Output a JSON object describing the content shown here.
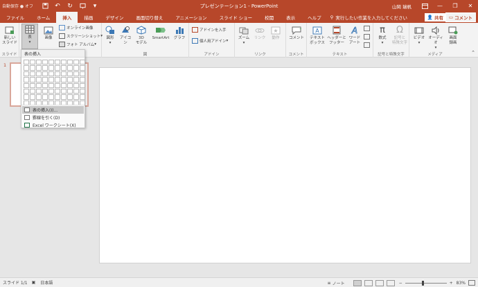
{
  "titlebar": {
    "autosave": "自動保存 ● オフ",
    "title": "プレゼンテーション1 - PowerPoint",
    "user": "山岡 瑞帆"
  },
  "tabs": [
    "ファイル",
    "ホーム",
    "挿入",
    "描画",
    "デザイン",
    "画面切り替え",
    "アニメーション",
    "スライド ショー",
    "校閲",
    "表示",
    "ヘルプ"
  ],
  "active_tab": "挿入",
  "tellme": "実行したい作業を入力してください",
  "share": "共有",
  "comment": "コメント",
  "ribbon": {
    "new_slide": "新しい\nスライド",
    "table": "表",
    "images": "画像",
    "online_images": "オンライン画像",
    "screenshot": "スクリーンショット",
    "photo_album": "フォト アルバム",
    "shapes": "図形",
    "icons": "アイコン",
    "models3d": "3D\nモデル",
    "smartart": "SmartArt",
    "graph": "グラフ",
    "get_addins": "アドインを入手",
    "my_addins": "個人用アドイン",
    "zoom": "ズーム",
    "link": "リンク",
    "action": "動作",
    "comment": "コメント",
    "textbox": "テキスト\nボックス",
    "header_footer": "ヘッダーと\nフッター",
    "wordart": "ワード\nアート",
    "equation": "数式",
    "symbol": "記号と\n特殊文字",
    "video": "ビデオ",
    "audio": "オーディオ",
    "screen_rec": "画面\n録画",
    "groups": {
      "slides": "スライド",
      "images": "画像",
      "figure": "図",
      "addins": "アドイン",
      "links": "リンク",
      "comment": "コメント",
      "text": "テキスト",
      "symbols": "記号と特殊文字",
      "media": "メディア"
    }
  },
  "dropdown": {
    "title": "表の挿入",
    "insert_table": "表の挿入(I)...",
    "draw_table": "罫線を引く(D)",
    "excel_sheet": "Excel ワークシート(X)"
  },
  "thumbnail_number": "1",
  "status": {
    "slide": "スライド 1/1",
    "language": "日本語",
    "notes": "ノート",
    "zoom": "83%"
  },
  "zoom_level": 0.83
}
